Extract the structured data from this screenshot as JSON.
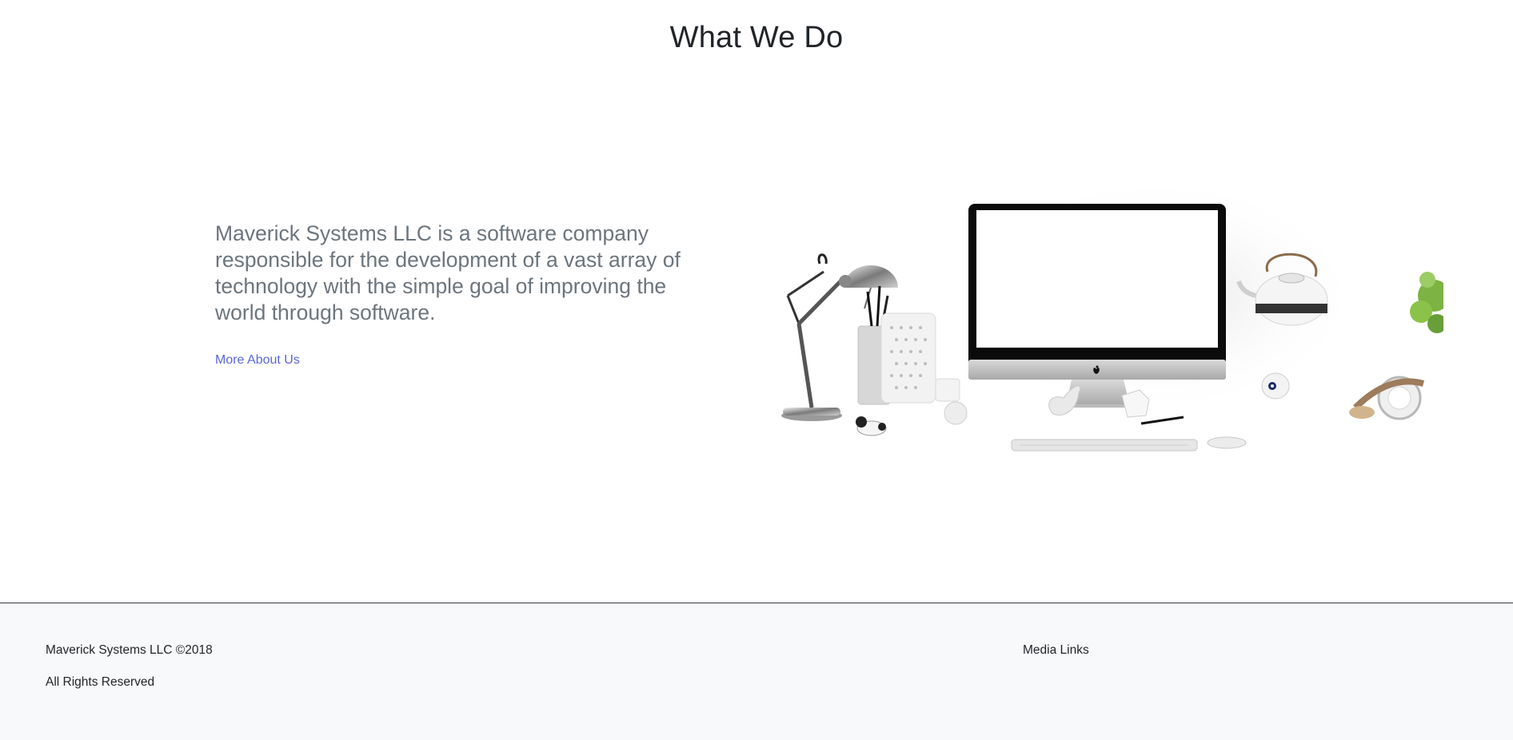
{
  "section": {
    "title": "What We Do"
  },
  "about": {
    "text": "Maverick Systems LLC is a software company responsible for the development of a vast array of technology with the simple goal of improving the world through software.",
    "link_label": "More About Us"
  },
  "hero_image": {
    "description_icon": "desk-workspace-illustration"
  },
  "footer": {
    "copyright": "Maverick Systems LLC ©2018",
    "rights": "All Rights Reserved",
    "media_links": "Media Links"
  },
  "colors": {
    "link": "#5a67d8",
    "body_text": "#6c757d",
    "heading": "#212529",
    "footer_bg": "#f8f9fa",
    "footer_border": "#343a40"
  }
}
